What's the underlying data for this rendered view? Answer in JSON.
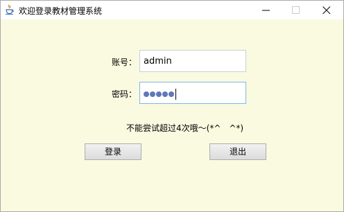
{
  "window": {
    "title": "欢迎登录教材管理系统",
    "icons": {
      "app": "java-cup-icon",
      "minimize": "minimize-icon",
      "maximize": "maximize-icon",
      "close": "close-icon"
    }
  },
  "form": {
    "account_label": "账号：",
    "account_value": "admin",
    "password_label": "密码：",
    "password_length": 5,
    "hint": "不能尝试超过4次哦～(*^　^*)"
  },
  "buttons": {
    "login": "登录",
    "exit": "退出"
  },
  "colors": {
    "background": "#fafae0",
    "field_focus_border": "#7ab8e8",
    "password_dot": "#5f78b8"
  }
}
